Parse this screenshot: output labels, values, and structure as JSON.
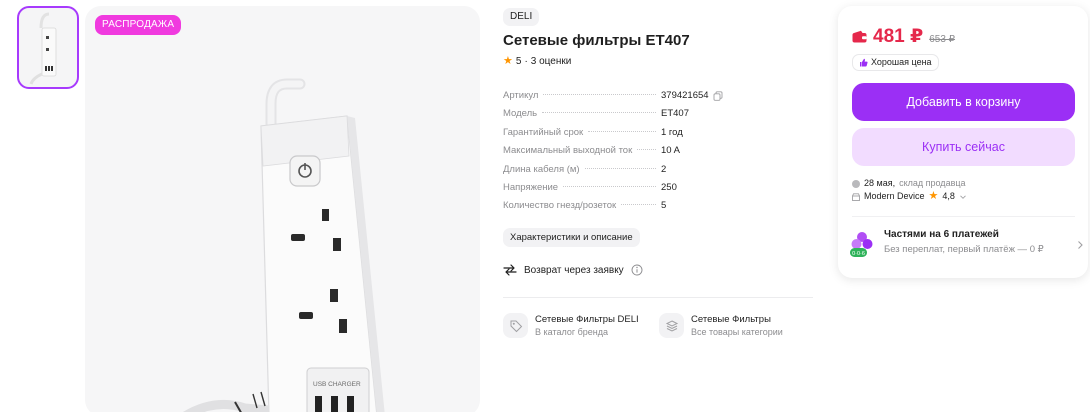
{
  "gallery": {
    "sale_badge": "РАСПРОДАЖА"
  },
  "product": {
    "brand": "DELI",
    "title": "Сетевые фильтры ET407",
    "rating": "5",
    "rating_separator": "·",
    "reviews": "3 оценки",
    "specs": [
      {
        "key": "Артикул",
        "value": "379421654"
      },
      {
        "key": "Модель",
        "value": "ET407"
      },
      {
        "key": "Гарантийный срок",
        "value": "1 год"
      },
      {
        "key": "Максимальный выходной ток",
        "value": "10 A"
      },
      {
        "key": "Длина кабеля (м)",
        "value": "2"
      },
      {
        "key": "Напряжение",
        "value": "250"
      },
      {
        "key": "Количество гнезд/розеток",
        "value": "5"
      }
    ],
    "characteristics_link": "Характеристики и описание",
    "return_text": "Возврат через заявку",
    "catalog_cards": [
      {
        "title": "Сетевые Фильтры DELI",
        "subtitle": "В каталог бренда",
        "icon": "tag-icon"
      },
      {
        "title": "Сетевые Фильтры",
        "subtitle": "Все товары категории",
        "icon": "layers-icon"
      }
    ]
  },
  "buy_box": {
    "price": "481 ₽",
    "old_price": "653 ₽",
    "good_price_label": "Хорошая цена",
    "add_to_cart": "Добавить в корзину",
    "buy_now": "Купить сейчас",
    "delivery_date": "28 мая,",
    "delivery_source": "склад продавца",
    "seller_name": "Modern Device",
    "seller_rating": "4,8",
    "installments_title": "Частями на 6 платежей",
    "installments_subtitle": "Без переплат, первый платёж — 0 ₽",
    "installments_badge": "0·0·6"
  },
  "colors": {
    "accent": "#9b2ff5",
    "sale_badge": "#f03adf",
    "price_red": "#e5284b",
    "star": "#ff9500",
    "muted": "#8c8c8f"
  }
}
